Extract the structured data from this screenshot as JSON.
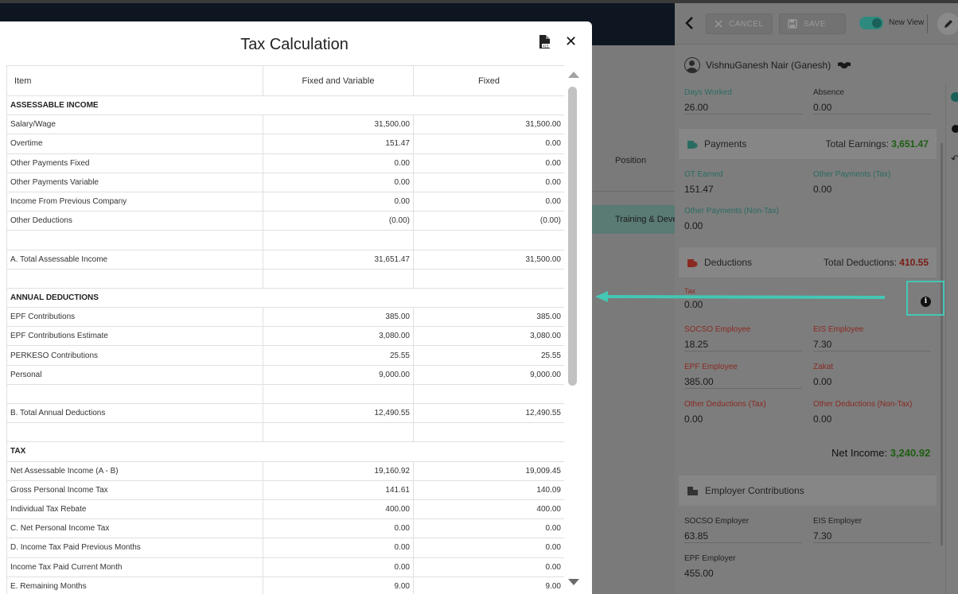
{
  "background": {
    "position_label": "Position",
    "training_label": "Training & Deve"
  },
  "toolbar": {
    "cancel_label": "CANCEL",
    "save_label": "SAVE",
    "new_view_label": "New View"
  },
  "employee": {
    "name": "VishnuGanesh Nair (Ganesh)"
  },
  "panel": {
    "days_worked": {
      "label": "Days Worked",
      "value": "26.00"
    },
    "absence": {
      "label": "Absence",
      "value": "0.00"
    },
    "payments": {
      "title": "Payments",
      "total_label": "Total Earnings:",
      "total_value": "3,651.47",
      "ot_earned": {
        "label": "OT Earned",
        "value": "151.47"
      },
      "other_tax": {
        "label": "Other Payments (Tax)",
        "value": "0.00"
      },
      "other_nontax": {
        "label": "Other Payments (Non-Tax)",
        "value": "0.00"
      }
    },
    "deductions": {
      "title": "Deductions",
      "total_label": "Total Deductions:",
      "total_value": "410.55",
      "tax": {
        "label": "Tax",
        "value": "0.00"
      },
      "socso_emp": {
        "label": "SOCSO Employee",
        "value": "18.25"
      },
      "eis_emp": {
        "label": "EIS Employee",
        "value": "7.30"
      },
      "epf_emp": {
        "label": "EPF Employee",
        "value": "385.00"
      },
      "zakat": {
        "label": "Zakat",
        "value": "0.00"
      },
      "other_ded_tax": {
        "label": "Other Deductions (Tax)",
        "value": "0.00"
      },
      "other_ded_nontax": {
        "label": "Other Deductions (Non-Tax)",
        "value": "0.00"
      }
    },
    "net_income": {
      "label": "Net Income:",
      "value": "3,240.92"
    },
    "employer": {
      "title": "Employer Contributions",
      "socso": {
        "label": "SOCSO Employer",
        "value": "63.85"
      },
      "eis": {
        "label": "EIS Employer",
        "value": "7.30"
      },
      "epf": {
        "label": "EPF Employer",
        "value": "455.00"
      }
    }
  },
  "modal": {
    "title": "Tax Calculation",
    "columns": [
      "Item",
      "Fixed and Variable",
      "Fixed"
    ],
    "rows": [
      {
        "type": "section",
        "label": "ASSESSABLE INCOME"
      },
      {
        "type": "row",
        "label": "Salary/Wage",
        "a": "31,500.00",
        "b": "31,500.00"
      },
      {
        "type": "row",
        "label": "Overtime",
        "a": "151.47",
        "b": "0.00"
      },
      {
        "type": "row",
        "label": "Other Payments Fixed",
        "a": "0.00",
        "b": "0.00"
      },
      {
        "type": "row",
        "label": "Other Payments Variable",
        "a": "0.00",
        "b": "0.00"
      },
      {
        "type": "row",
        "label": "Income From Previous Company",
        "a": "0.00",
        "b": "0.00"
      },
      {
        "type": "row",
        "label": "Other Deductions",
        "a": "(0.00)",
        "b": "(0.00)"
      },
      {
        "type": "row",
        "label": "",
        "a": "",
        "b": ""
      },
      {
        "type": "row",
        "label": "A. Total Assessable Income",
        "a": "31,651.47",
        "b": "31,500.00"
      },
      {
        "type": "row",
        "label": "",
        "a": "",
        "b": ""
      },
      {
        "type": "section",
        "label": "ANNUAL DEDUCTIONS"
      },
      {
        "type": "row",
        "label": "EPF Contributions",
        "a": "385.00",
        "b": "385.00"
      },
      {
        "type": "row",
        "label": "EPF Contributions Estimate",
        "a": "3,080.00",
        "b": "3,080.00"
      },
      {
        "type": "row",
        "label": "PERKESO Contributions",
        "a": "25.55",
        "b": "25.55"
      },
      {
        "type": "row",
        "label": "Personal",
        "a": "9,000.00",
        "b": "9,000.00"
      },
      {
        "type": "row",
        "label": "",
        "a": "",
        "b": ""
      },
      {
        "type": "row",
        "label": "B. Total Annual Deductions",
        "a": "12,490.55",
        "b": "12,490.55"
      },
      {
        "type": "row",
        "label": "",
        "a": "",
        "b": ""
      },
      {
        "type": "section",
        "label": "TAX"
      },
      {
        "type": "row",
        "label": "Net Assessable Income (A - B)",
        "a": "19,160.92",
        "b": "19,009.45"
      },
      {
        "type": "row",
        "label": "Gross Personal Income Tax",
        "a": "141.61",
        "b": "140.09"
      },
      {
        "type": "row",
        "label": "Individual Tax Rebate",
        "a": "400.00",
        "b": "400.00"
      },
      {
        "type": "row",
        "label": "C. Net Personal Income Tax",
        "a": "0.00",
        "b": "0.00"
      },
      {
        "type": "row",
        "label": "D. Income Tax Paid Previous Months",
        "a": "0.00",
        "b": "0.00"
      },
      {
        "type": "row",
        "label": "Income Tax Paid Current Month",
        "a": "0.00",
        "b": "0.00"
      },
      {
        "type": "row",
        "label": "E. Remaining Months",
        "a": "9.00",
        "b": "9.00"
      }
    ]
  },
  "colors": {
    "accent_teal": "#44c7b4",
    "earnings_green": "#3aa12a",
    "deductions_red": "#d9362a"
  }
}
